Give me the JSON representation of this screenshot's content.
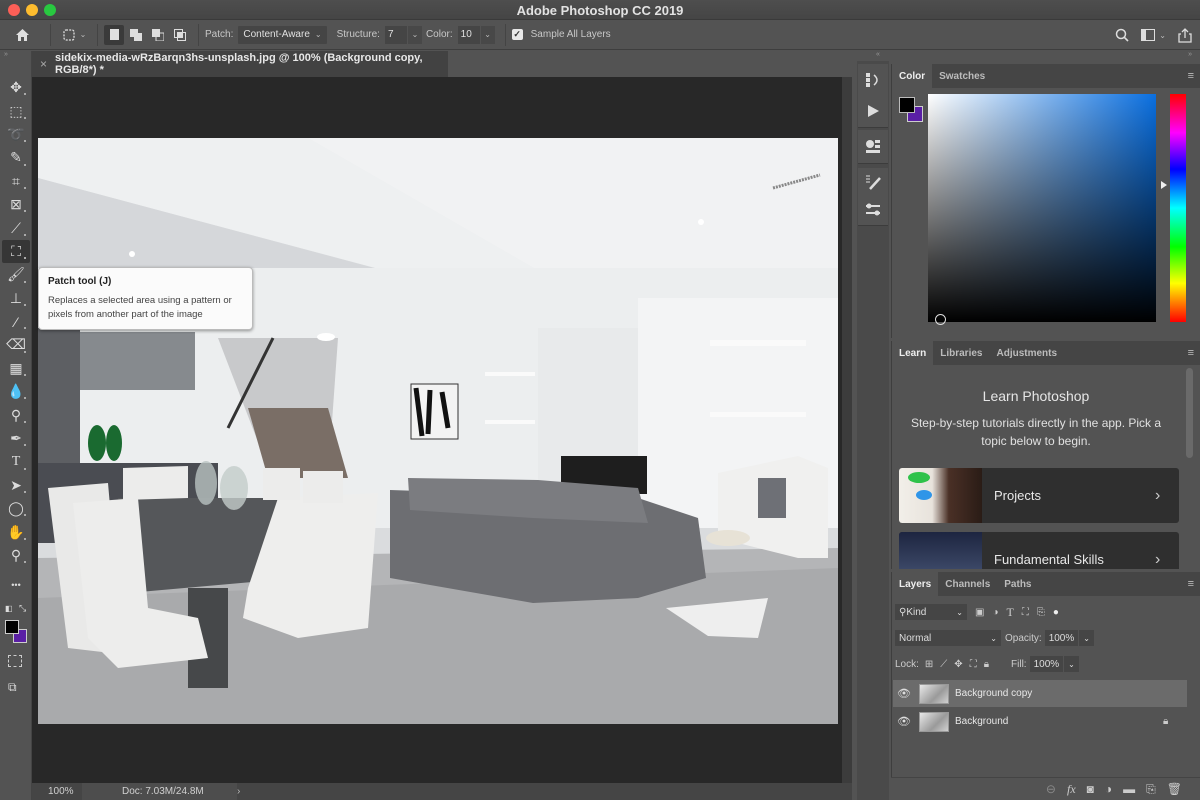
{
  "window": {
    "title": "Adobe Photoshop CC 2019",
    "traffic_lights": [
      "close",
      "minimize",
      "zoom"
    ]
  },
  "options_bar": {
    "home_icon": "home-icon",
    "tool_preset_icon": "patch-tool-icon",
    "selection_modes": [
      "new-selection",
      "add-to-selection",
      "subtract-from-selection",
      "intersect-with-selection"
    ],
    "active_mode": "new-selection",
    "patch_label": "Patch:",
    "patch_value": "Content-Aware",
    "structure_label": "Structure:",
    "structure_value": "7",
    "color_label": "Color:",
    "color_value": "10",
    "sample_all_layers_label": "Sample All Layers",
    "sample_all_layers_checked": true,
    "right_icons": [
      "search-icon",
      "workspace-icon",
      "share-icon"
    ]
  },
  "document": {
    "tab_title": "sidekix-media-wRzBarqn3hs-unsplash.jpg @ 100% (Background copy, RGB/8*) *",
    "close_glyph": "×",
    "zoom": "100%",
    "doc_info": "Doc: 7.03M/24.8M",
    "status_arrow": "›"
  },
  "toolbox": {
    "tools": [
      {
        "name": "move",
        "glyph": "✥"
      },
      {
        "name": "rectangular-marquee",
        "glyph": "⬚"
      },
      {
        "name": "lasso",
        "glyph": "➰"
      },
      {
        "name": "quick-selection",
        "glyph": "✎"
      },
      {
        "name": "crop",
        "glyph": "⌗"
      },
      {
        "name": "frame",
        "glyph": "⊠"
      },
      {
        "name": "eyedropper",
        "glyph": "⟋"
      },
      {
        "name": "patch",
        "glyph": "⛶",
        "active": true
      },
      {
        "name": "brush",
        "glyph": "🖌"
      },
      {
        "name": "clone-stamp",
        "glyph": "⊥"
      },
      {
        "name": "history-brush",
        "glyph": "⁄"
      },
      {
        "name": "eraser",
        "glyph": "⌫"
      },
      {
        "name": "gradient",
        "glyph": "▦"
      },
      {
        "name": "blur",
        "glyph": "💧"
      },
      {
        "name": "dodge",
        "glyph": "⚲"
      },
      {
        "name": "pen",
        "glyph": "✒"
      },
      {
        "name": "type",
        "glyph": "T"
      },
      {
        "name": "path-selection",
        "glyph": "➤"
      },
      {
        "name": "ellipse",
        "glyph": "◯"
      },
      {
        "name": "hand",
        "glyph": "✋"
      },
      {
        "name": "zoom",
        "glyph": "⚲"
      },
      {
        "name": "edit-toolbar",
        "glyph": "•••"
      }
    ],
    "foreground_color": "#000000",
    "background_color": "#5a1fa5"
  },
  "tooltip": {
    "title": "Patch tool (J)",
    "body": "Replaces a selected area using a pattern or pixels from another part of the image"
  },
  "dock_icons": [
    "history-icon",
    "actions-play-icon",
    "properties-icon",
    "brush-settings-icon",
    "adjustments-sliders-icon"
  ],
  "color_panel": {
    "tabs": [
      "Color",
      "Swatches"
    ],
    "active_tab": "Color",
    "foreground": "#000000",
    "background": "#5a1fa5",
    "field_hue": "#0a6fe0"
  },
  "learn_panel": {
    "tabs": [
      "Learn",
      "Libraries",
      "Adjustments"
    ],
    "active_tab": "Learn",
    "title": "Learn Photoshop",
    "subtitle": "Step-by-step tutorials directly in the app. Pick a topic below to begin.",
    "cards": [
      {
        "title": "Projects",
        "chevron": "›"
      },
      {
        "title": "Fundamental Skills",
        "chevron": "›"
      }
    ]
  },
  "layers_panel": {
    "tabs": [
      "Layers",
      "Channels",
      "Paths"
    ],
    "active_tab": "Layers",
    "filter_label": "Kind",
    "blend_mode": "Normal",
    "opacity_label": "Opacity:",
    "opacity_value": "100%",
    "lock_label": "Lock:",
    "fill_label": "Fill:",
    "fill_value": "100%",
    "layers": [
      {
        "name": "Background copy",
        "visible": true,
        "selected": true,
        "locked": false
      },
      {
        "name": "Background",
        "visible": true,
        "selected": false,
        "locked": true
      }
    ],
    "footer_icons": [
      "link-icon",
      "fx-icon",
      "mask-icon",
      "adjustment-layer-icon",
      "group-folder-icon",
      "new-layer-icon",
      "trash-icon"
    ]
  }
}
